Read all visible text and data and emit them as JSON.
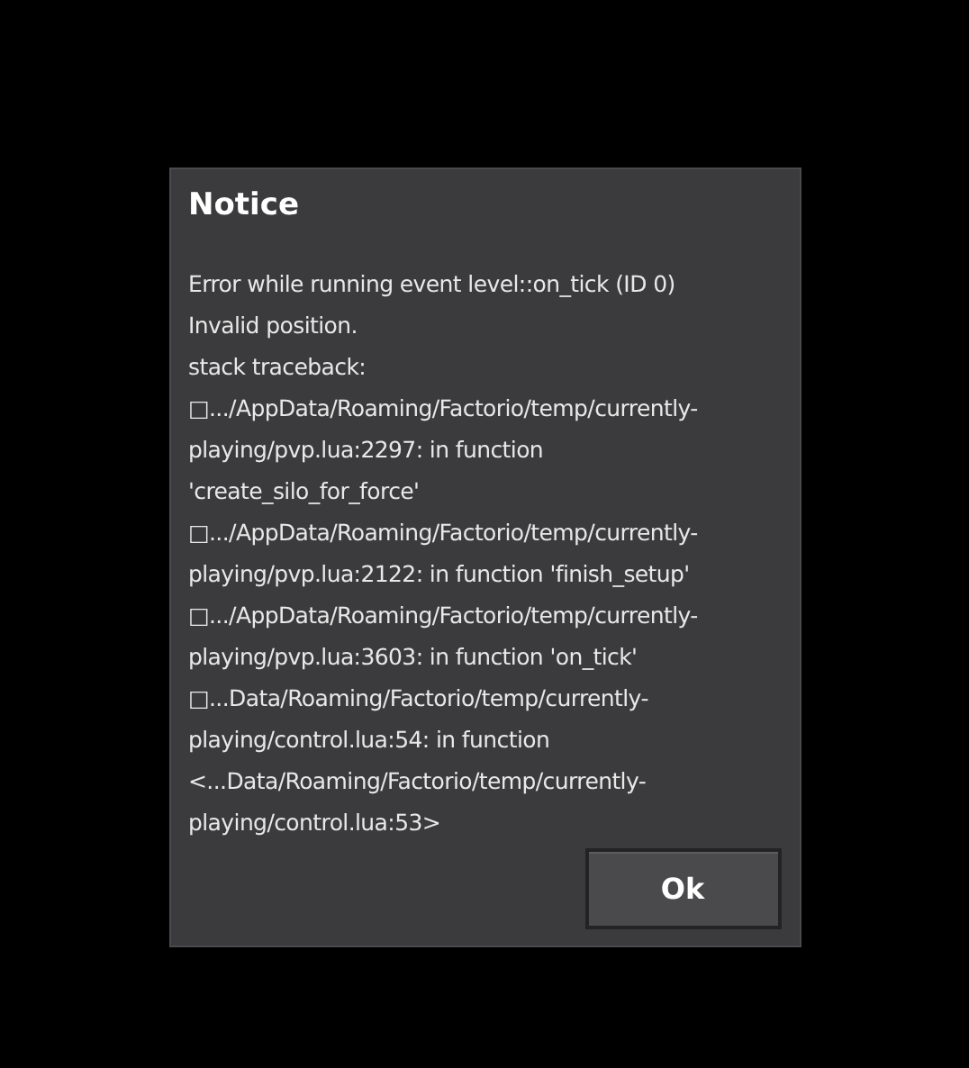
{
  "dialog": {
    "title": "Notice",
    "message_lines": [
      "Error while running event level::on_tick (ID 0)",
      "Invalid position.",
      "stack traceback:",
      "□.../AppData/Roaming/Factorio/temp/currently-",
      "playing/pvp.lua:2297: in function",
      "'create_silo_for_force'",
      "□.../AppData/Roaming/Factorio/temp/currently-",
      "playing/pvp.lua:2122: in function 'finish_setup'",
      "□.../AppData/Roaming/Factorio/temp/currently-",
      "playing/pvp.lua:3603: in function 'on_tick'",
      "□...Data/Roaming/Factorio/temp/currently-",
      "playing/control.lua:54: in function",
      "<...Data/Roaming/Factorio/temp/currently-",
      "playing/control.lua:53>"
    ],
    "buttons": [
      "Ok"
    ]
  }
}
